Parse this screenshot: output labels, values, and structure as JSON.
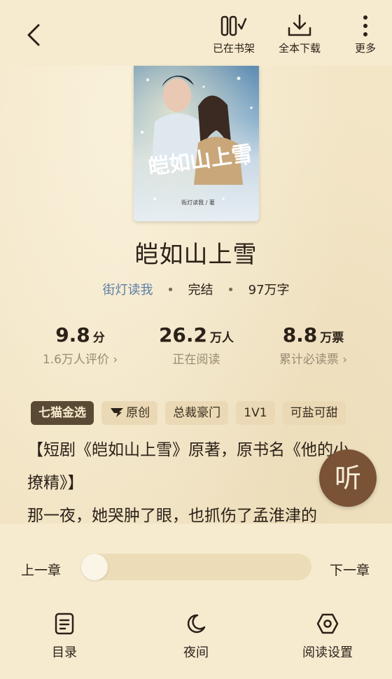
{
  "topbar": {
    "actions": [
      {
        "label": "已在书架",
        "icon": "bookshelf-icon"
      },
      {
        "label": "全本下载",
        "icon": "download-icon"
      },
      {
        "label": "更多",
        "icon": "more-vertical-icon"
      }
    ]
  },
  "book": {
    "cover": {
      "title_art": "皑如山上雪",
      "author_line": "街灯读我 / 著"
    },
    "title": "皑如山上雪",
    "author": "街灯读我",
    "status": "完结",
    "word_count": "97万字",
    "dot": "•"
  },
  "stats": [
    {
      "value": "9.8",
      "unit": "分",
      "label": "1.6万人评价"
    },
    {
      "value": "26.2",
      "unit": "万人",
      "label": "正在阅读"
    },
    {
      "value": "8.8",
      "unit": "万票",
      "label": "累计必读票"
    }
  ],
  "tags": [
    "七猫金选",
    "原创",
    "总裁豪门",
    "1V1",
    "可盐可甜"
  ],
  "description": {
    "line1": "【短剧《皑如山上雪》原著，原书名《他的小",
    "line2": "撩精》】",
    "line3": "那一夜，她哭肿了眼，也抓伤了孟淮津的"
  },
  "listen": {
    "label": "听"
  },
  "reader": {
    "prev": "上一章",
    "next": "下一章",
    "progress": 0,
    "actions": [
      {
        "label": "目录",
        "icon": "toc-icon"
      },
      {
        "label": "夜间",
        "icon": "night-mode-icon"
      },
      {
        "label": "阅读设置",
        "icon": "settings-icon"
      }
    ]
  },
  "colors": {
    "background": "#f3e6c7",
    "accent": "#7a5236",
    "author_link": "#5b7fa6"
  }
}
